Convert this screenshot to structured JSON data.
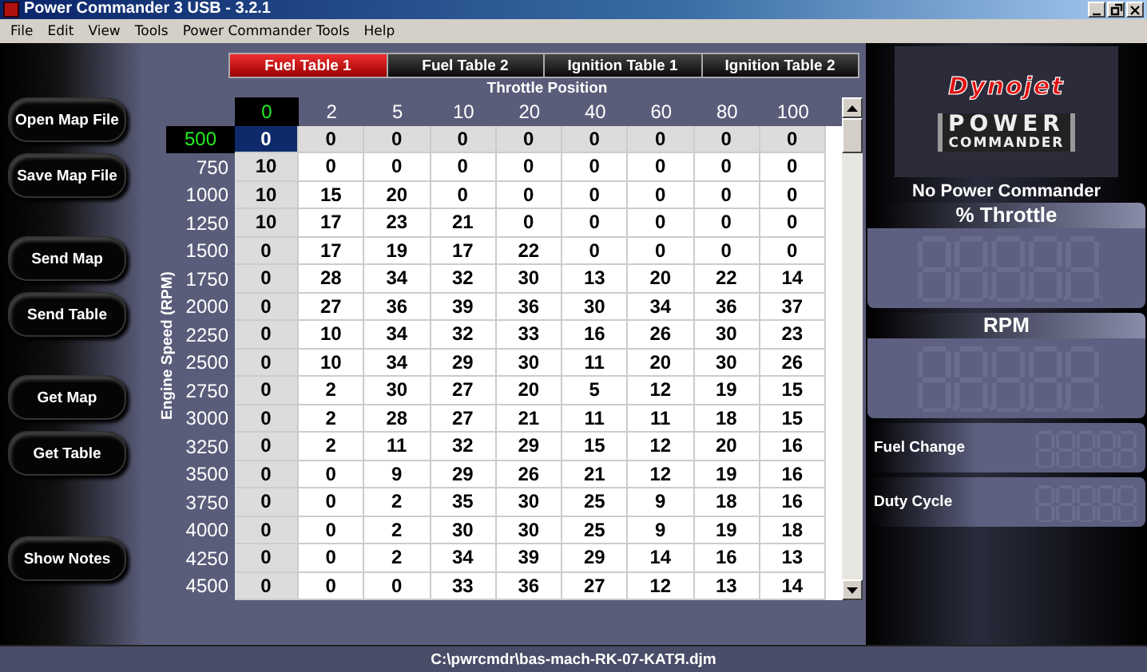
{
  "window": {
    "title": "Power Commander 3 USB - 3.2.1"
  },
  "menu": [
    "File",
    "Edit",
    "View",
    "Tools",
    "Power Commander Tools",
    "Help"
  ],
  "button_groups": [
    [
      "Open Map File",
      "Save Map File"
    ],
    [
      "Send Map",
      "Send Table"
    ],
    [
      "Get Map",
      "Get Table"
    ],
    [
      "Show Notes"
    ]
  ],
  "tabs": [
    {
      "label": "Fuel Table 1",
      "selected": true
    },
    {
      "label": "Fuel Table 2",
      "selected": false
    },
    {
      "label": "Ignition Table 1",
      "selected": false
    },
    {
      "label": "Ignition Table 2",
      "selected": false
    }
  ],
  "table": {
    "x_axis_label": "Throttle Position",
    "y_axis_label": "Engine Speed (RPM)",
    "columns": [
      {
        "label": "0",
        "selected": true
      },
      {
        "label": "2",
        "selected": false
      },
      {
        "label": "5",
        "selected": false
      },
      {
        "label": "10",
        "selected": false
      },
      {
        "label": "20",
        "selected": false
      },
      {
        "label": "40",
        "selected": false
      },
      {
        "label": "60",
        "selected": false
      },
      {
        "label": "80",
        "selected": false
      },
      {
        "label": "100",
        "selected": false
      }
    ],
    "rows": [
      {
        "rpm": "500",
        "selected": true,
        "cells": [
          "0",
          "0",
          "0",
          "0",
          "0",
          "0",
          "0",
          "0",
          "0"
        ]
      },
      {
        "rpm": "750",
        "selected": false,
        "cells": [
          "10",
          "0",
          "0",
          "0",
          "0",
          "0",
          "0",
          "0",
          "0"
        ]
      },
      {
        "rpm": "1000",
        "selected": false,
        "cells": [
          "10",
          "15",
          "20",
          "0",
          "0",
          "0",
          "0",
          "0",
          "0"
        ]
      },
      {
        "rpm": "1250",
        "selected": false,
        "cells": [
          "10",
          "17",
          "23",
          "21",
          "0",
          "0",
          "0",
          "0",
          "0"
        ]
      },
      {
        "rpm": "1500",
        "selected": false,
        "cells": [
          "0",
          "17",
          "19",
          "17",
          "22",
          "0",
          "0",
          "0",
          "0"
        ]
      },
      {
        "rpm": "1750",
        "selected": false,
        "cells": [
          "0",
          "28",
          "34",
          "32",
          "30",
          "13",
          "20",
          "22",
          "14"
        ]
      },
      {
        "rpm": "2000",
        "selected": false,
        "cells": [
          "0",
          "27",
          "36",
          "39",
          "36",
          "30",
          "34",
          "36",
          "37"
        ]
      },
      {
        "rpm": "2250",
        "selected": false,
        "cells": [
          "0",
          "10",
          "34",
          "32",
          "33",
          "16",
          "26",
          "30",
          "23"
        ]
      },
      {
        "rpm": "2500",
        "selected": false,
        "cells": [
          "0",
          "10",
          "34",
          "29",
          "30",
          "11",
          "20",
          "30",
          "26"
        ]
      },
      {
        "rpm": "2750",
        "selected": false,
        "cells": [
          "0",
          "2",
          "30",
          "27",
          "20",
          "5",
          "12",
          "19",
          "15"
        ]
      },
      {
        "rpm": "3000",
        "selected": false,
        "cells": [
          "0",
          "2",
          "28",
          "27",
          "21",
          "11",
          "11",
          "18",
          "15"
        ]
      },
      {
        "rpm": "3250",
        "selected": false,
        "cells": [
          "0",
          "2",
          "11",
          "32",
          "29",
          "15",
          "12",
          "20",
          "16"
        ]
      },
      {
        "rpm": "3500",
        "selected": false,
        "cells": [
          "0",
          "0",
          "9",
          "29",
          "26",
          "21",
          "12",
          "19",
          "16"
        ]
      },
      {
        "rpm": "3750",
        "selected": false,
        "cells": [
          "0",
          "0",
          "2",
          "35",
          "30",
          "25",
          "9",
          "18",
          "16"
        ]
      },
      {
        "rpm": "4000",
        "selected": false,
        "cells": [
          "0",
          "0",
          "2",
          "30",
          "30",
          "25",
          "9",
          "19",
          "18"
        ]
      },
      {
        "rpm": "4250",
        "selected": false,
        "cells": [
          "0",
          "0",
          "2",
          "34",
          "39",
          "29",
          "14",
          "16",
          "13"
        ]
      },
      {
        "rpm": "4500",
        "selected": false,
        "cells": [
          "0",
          "0",
          "0",
          "33",
          "36",
          "27",
          "12",
          "13",
          "14"
        ]
      }
    ]
  },
  "logo": {
    "brand": "Dynojet",
    "line_1": "POWER",
    "line_2": "COMMANDER"
  },
  "connection_status": "No Power Commander",
  "gauges": [
    {
      "label": "% Throttle",
      "kind": "large"
    },
    {
      "label": "RPM",
      "kind": "large"
    },
    {
      "label": "Fuel Change",
      "kind": "small"
    },
    {
      "label": "Duty Cycle",
      "kind": "small"
    }
  ],
  "status_bar": {
    "file_path": "C:\\pwrcmdr\\bas-mach-RK-07-KATЯ.djm"
  }
}
